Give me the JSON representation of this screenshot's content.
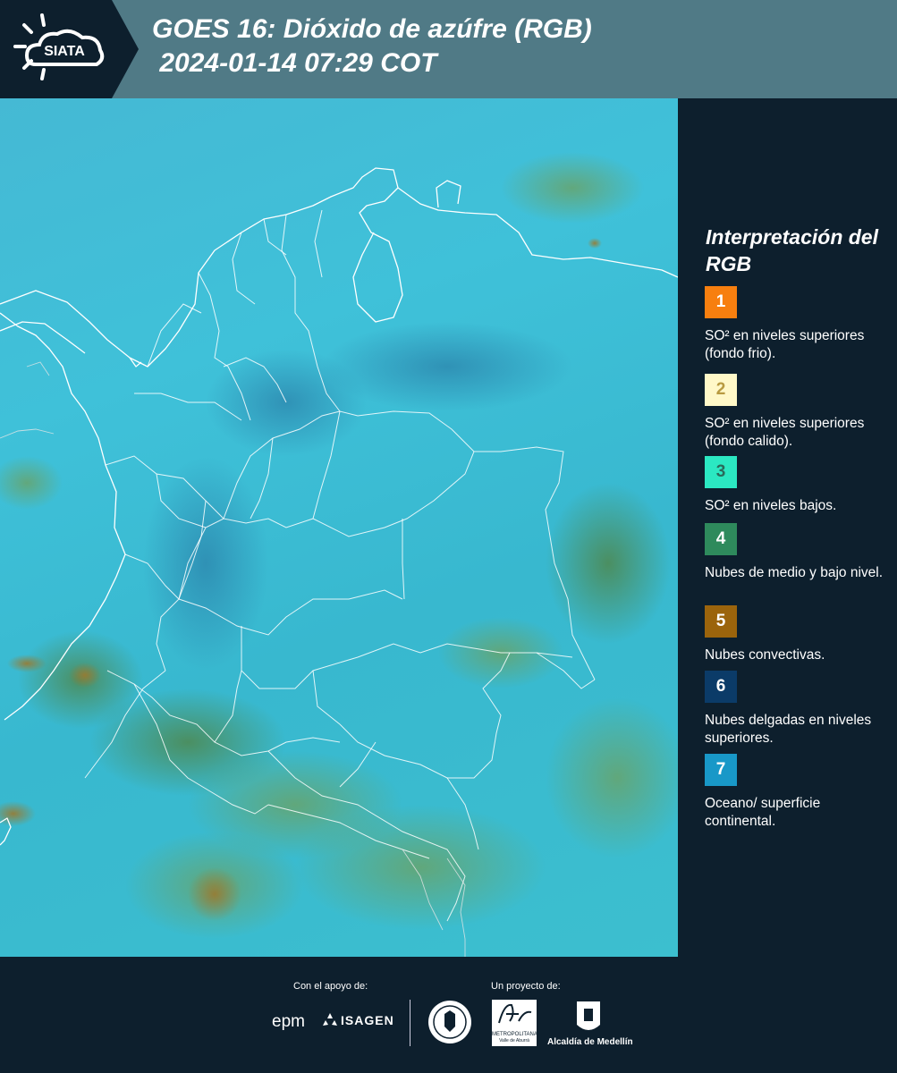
{
  "header": {
    "logo_text": "SIATA",
    "title": "GOES 16: Dióxido de azúfre (RGB)\n 2024-01-14 07:29 COT"
  },
  "legend": {
    "title": "Interpretación del RGB",
    "items": [
      {
        "number": "1",
        "text": "SO² en niveles superiores (fondo frio).",
        "color": "#f77f0f",
        "num_color": "#ffffff"
      },
      {
        "number": "2",
        "text": "SO² en niveles superiores (fondo calido).",
        "color": "#fff8c8",
        "num_color": "#b89a40"
      },
      {
        "number": "3",
        "text": "SO² en niveles bajos.",
        "color": "#2be8c2",
        "num_color": "#2a6a5a"
      },
      {
        "number": "4",
        "text": "Nubes de medio y bajo nivel.",
        "color": "#2e8a5c",
        "num_color": "#ffffff"
      },
      {
        "number": "5",
        "text": "Nubes convectivas.",
        "color": "#9b640c",
        "num_color": "#ffffff"
      },
      {
        "number": "6",
        "text": "Nubes delgadas en niveles superiores.",
        "color": "#0b3b68",
        "num_color": "#ffffff"
      },
      {
        "number": "7",
        "text": "Oceano/ superficie continental.",
        "color": "#1898c8",
        "num_color": "#ffffff"
      }
    ]
  },
  "footer": {
    "support_label": "Con el apoyo de:",
    "project_label": "Un proyecto de:",
    "epm": "epm",
    "isagen": "ISAGEN",
    "area_metro": "METROPOLITANA",
    "area_sub": "Valle de Aburrá",
    "alcaldia": "Alcaldía de Medellín"
  }
}
